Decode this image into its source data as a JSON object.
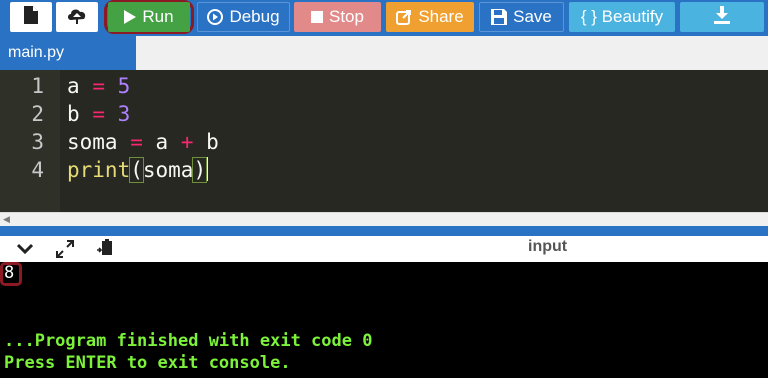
{
  "toolbar": {
    "buttons": [
      {
        "label": "Run",
        "icon": "play-icon",
        "color": "#44a244"
      },
      {
        "label": "Debug",
        "icon": "debug-icon",
        "color": "#2a72c4"
      },
      {
        "label": "Stop",
        "icon": "stop-icon",
        "color": "#e28a8a"
      },
      {
        "label": "Share",
        "icon": "share-icon",
        "color": "#f0a030"
      },
      {
        "label": "Save",
        "icon": "save-icon",
        "color": "#2a72c4"
      },
      {
        "label": "{ } Beautify",
        "icon": "beautify-icon",
        "color": "#4ab3e0"
      }
    ],
    "download_color": "#4ab3e0",
    "highlight_color": "#8b1a24"
  },
  "tabs": [
    {
      "label": "main.py"
    }
  ],
  "editor": {
    "line_numbers": [
      "1",
      "2",
      "3",
      "4"
    ],
    "lines": [
      {
        "var": "a",
        "op": "=",
        "val": "5"
      },
      {
        "var": "b",
        "op": "=",
        "val": "3"
      },
      {
        "lhs": "soma",
        "op": "=",
        "a": "a",
        "plus": "+",
        "b": "b"
      },
      {
        "fn": "print",
        "open": "(",
        "arg": "soma",
        "close": ")"
      }
    ]
  },
  "output_panel": {
    "label": "input"
  },
  "console": {
    "output": "8",
    "finished": "...Program finished with exit code 0",
    "press_enter": "Press ENTER to exit console."
  }
}
